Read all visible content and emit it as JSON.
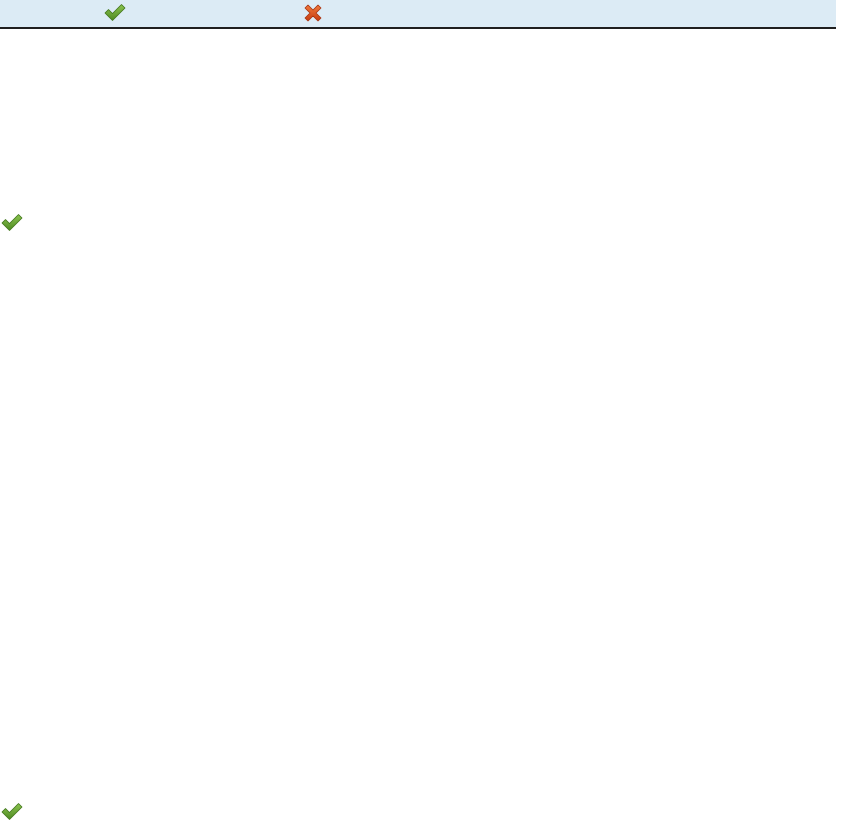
{
  "header": {
    "background_color": "#dcebf5",
    "border_color": "#1f1f1f",
    "columns": [
      {
        "icon": "check-icon",
        "color": "#5f9b2c"
      },
      {
        "icon": "cross-icon",
        "color": "#d9541e"
      }
    ]
  },
  "rows": [
    {
      "icon": "check-icon",
      "color": "#5f9b2c"
    },
    {
      "icon": "check-icon",
      "color": "#5f9b2c"
    }
  ]
}
